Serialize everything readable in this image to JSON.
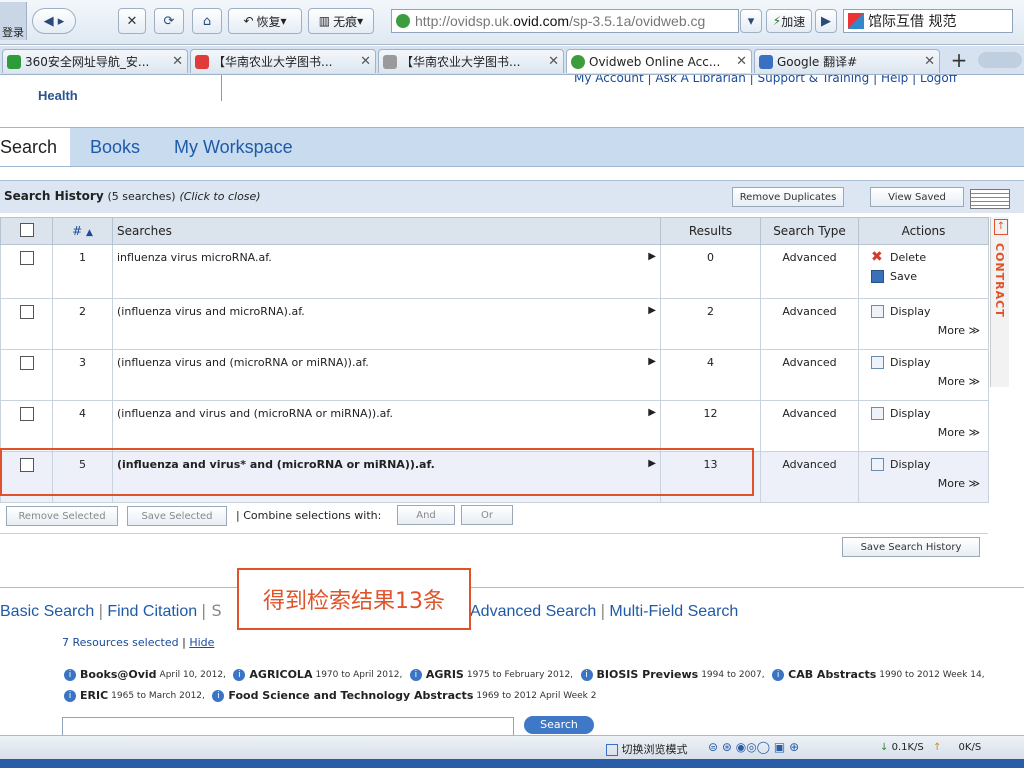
{
  "browser": {
    "restore_label": "恢复",
    "no_trace_label": "无痕",
    "address": {
      "prefix": "http://ovidsp.uk.",
      "host": "ovid.com",
      "path": "/sp-3.5.1a/ovidweb.cg"
    },
    "accelerate_label": "加速",
    "search_engine_text": "馆际互借 规范",
    "login_label": "登录",
    "tabs": [
      {
        "title": "360安全网址导航_安...",
        "color": "#2e9b3c"
      },
      {
        "title": "【华南农业大学图书...",
        "color": "#e03a3a"
      },
      {
        "title": "【华南农业大学图书...",
        "color": "#9a9a9a"
      },
      {
        "title": "Ovidweb Online Acc...",
        "color": "#3d9d3d"
      },
      {
        "title": "Google 翻译#",
        "color": "#3a6fc4"
      }
    ]
  },
  "ovid": {
    "brand_sub": "Health",
    "top_links": [
      "My Account",
      "Ask A Librarian",
      "Support & Training",
      "Help",
      "Logoff"
    ],
    "nav_tabs": [
      "Search",
      "Books",
      "My Workspace"
    ]
  },
  "history": {
    "title": "Search History",
    "count": "(5 searches)",
    "toggle": "(Click to close)",
    "remove_duplicates": "Remove Duplicates",
    "view_saved": "View Saved",
    "columns": [
      "#",
      "Searches",
      "Results",
      "Search Type",
      "Actions"
    ],
    "sort_indicator": "▲",
    "rows": [
      {
        "num": "1",
        "query": "influenza virus microRNA.af.",
        "results": "0",
        "type": "Advanced",
        "actions": [
          "Delete",
          "Save"
        ]
      },
      {
        "num": "2",
        "query": "(influenza virus and microRNA).af.",
        "results": "2",
        "type": "Advanced",
        "actions": [
          "Display"
        ],
        "more": "More ≫"
      },
      {
        "num": "3",
        "query": "(influenza virus and (microRNA or miRNA)).af.",
        "results": "4",
        "type": "Advanced",
        "actions": [
          "Display"
        ],
        "more": "More ≫"
      },
      {
        "num": "4",
        "query": "(influenza and virus and (microRNA or miRNA)).af.",
        "results": "12",
        "type": "Advanced",
        "actions": [
          "Display"
        ],
        "more": "More ≫"
      },
      {
        "num": "5",
        "query": "(influenza and virus* and (microRNA or miRNA)).af.",
        "results": "13",
        "type": "Advanced",
        "actions": [
          "Display"
        ],
        "more": "More ≫"
      }
    ],
    "contract_label": "CONTRACT",
    "remove_selected": "Remove Selected",
    "save_selected": "Save Selected",
    "combine_label": "| Combine selections with:",
    "and_label": "And",
    "or_label": "Or",
    "save_history": "Save Search History"
  },
  "search_modes": [
    "Basic Search",
    "Find Citation",
    "Advanced Search",
    "Multi-Field Search"
  ],
  "resources": {
    "selected": "7 Resources selected",
    "hide": "Hide",
    "databases": [
      {
        "name": "Books@Ovid",
        "range": "April 10, 2012,"
      },
      {
        "name": "AGRICOLA",
        "range": "1970 to April 2012,"
      },
      {
        "name": "AGRIS",
        "range": "1975 to February 2012,"
      },
      {
        "name": "BIOSIS Previews",
        "range": "1994 to 2007,"
      },
      {
        "name": "CAB Abstracts",
        "range": "1990 to 2012 Week 14,"
      },
      {
        "name": "ERIC",
        "range": "1965 to March 2012,"
      },
      {
        "name": "Food Science and Technology Abstracts",
        "range": "1969 to 2012 April Week 2"
      }
    ],
    "search_button": "Search"
  },
  "annotation": "得到检索结果13条",
  "statusbar": {
    "mode": "切换浏览模式",
    "down": "0.1K/S",
    "up": "0K/S"
  }
}
